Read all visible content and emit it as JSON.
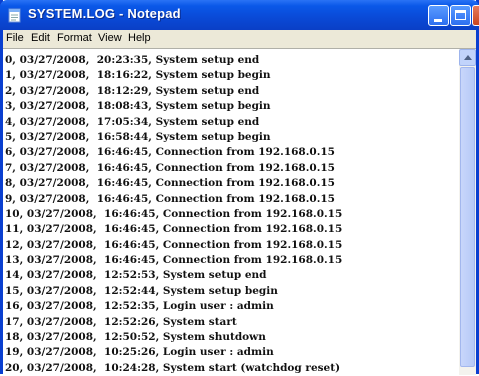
{
  "window": {
    "title": "SYSTEM.LOG - Notepad",
    "icon": "notepad-icon",
    "accent": "#0a49d6"
  },
  "menu": [
    "File",
    "Edit",
    "Format",
    "View",
    "Help"
  ],
  "log_lines": [
    "0, 03/27/2008,  20:23:35, System setup end",
    "1, 03/27/2008,  18:16:22, System setup begin",
    "2, 03/27/2008,  18:12:29, System setup end",
    "3, 03/27/2008,  18:08:43, System setup begin",
    "4, 03/27/2008,  17:05:34, System setup end",
    "5, 03/27/2008,  16:58:44, System setup begin",
    "6, 03/27/2008,  16:46:45, Connection from 192.168.0.15",
    "7, 03/27/2008,  16:46:45, Connection from 192.168.0.15",
    "8, 03/27/2008,  16:46:45, Connection from 192.168.0.15",
    "9, 03/27/2008,  16:46:45, Connection from 192.168.0.15",
    "10, 03/27/2008,  16:46:45, Connection from 192.168.0.15",
    "11, 03/27/2008,  16:46:45, Connection from 192.168.0.15",
    "12, 03/27/2008,  16:46:45, Connection from 192.168.0.15",
    "13, 03/27/2008,  16:46:45, Connection from 192.168.0.15",
    "14, 03/27/2008,  12:52:53, System setup end",
    "15, 03/27/2008,  12:52:44, System setup begin",
    "16, 03/27/2008,  12:52:35, Login user : admin",
    "17, 03/27/2008,  12:52:26, System start",
    "18, 03/27/2008,  12:50:52, System shutdown",
    "19, 03/27/2008,  10:25:26, Login user : admin",
    "20, 03/27/2008,  10:24:28, System start (watchdog reset)"
  ]
}
